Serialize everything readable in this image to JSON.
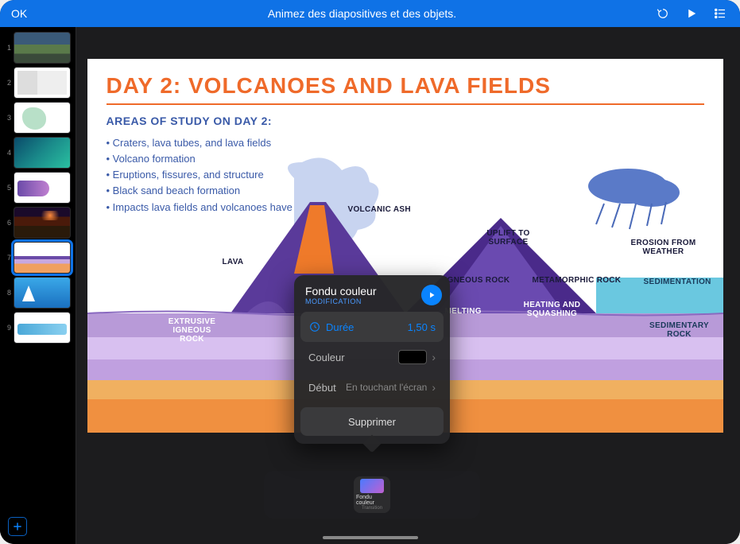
{
  "toolbar": {
    "ok": "OK",
    "title": "Animez des diapositives et des objets."
  },
  "slides": [
    {
      "n": "1"
    },
    {
      "n": "2"
    },
    {
      "n": "3"
    },
    {
      "n": "4"
    },
    {
      "n": "5"
    },
    {
      "n": "6"
    },
    {
      "n": "7"
    },
    {
      "n": "8"
    },
    {
      "n": "9"
    }
  ],
  "slide": {
    "title": "DAY 2: VOLCANOES AND LAVA FIELDS",
    "subtitle": "AREAS OF STUDY ON DAY 2:",
    "bullets": [
      "Craters, lava tubes, and lava fields",
      "Volcano formation",
      "Eruptions, fissures, and structure",
      "Black sand beach formation",
      "Impacts lava fields and volcanoes have on the land"
    ],
    "labels": {
      "volcanic_ash": "VOLCANIC ASH",
      "lava": "LAVA",
      "erosion": "EROSION FROM WEATHER",
      "uplift": "UPLIFT TO SURFACE",
      "igneous": "IGNEOUS ROCK",
      "ext_igneous": "EXTRUSIVE IGNEOUS ROCK",
      "metamorphic": "METAMORPHIC ROCK",
      "sedimentation": "SEDIMENTATION",
      "heating": "HEATING AND SQUASHING",
      "melting": "MELTING",
      "sedimentary": "SEDIMENTARY ROCK"
    }
  },
  "popover": {
    "name": "Fondu couleur",
    "subtitle": "MODIFICATION",
    "duration_label": "Durée",
    "duration_value": "1,50 s",
    "color_label": "Couleur",
    "start_label": "Début",
    "start_value": "En touchant l'écran",
    "delete": "Supprimer"
  },
  "transition_chip": {
    "name": "Fondu couleur",
    "sub": "Transition"
  }
}
